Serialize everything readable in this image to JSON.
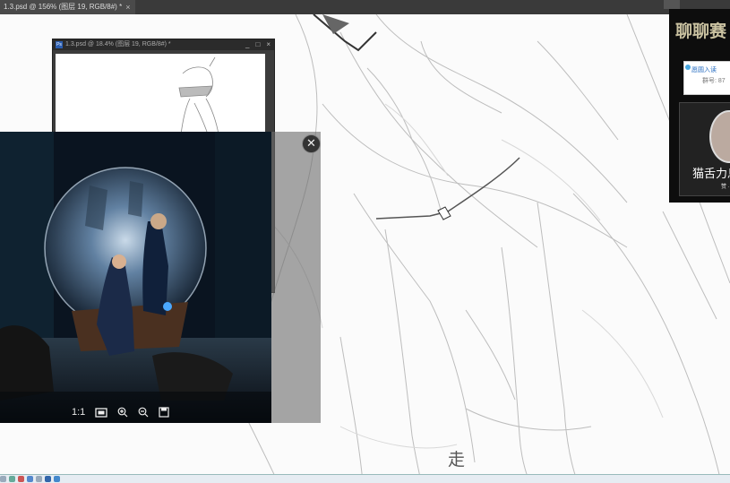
{
  "document_tab": {
    "title": "1.3.psd @ 156% (图层 19, RGB/8#) *",
    "close": "×"
  },
  "sub_window": {
    "title": "1.3.psd @ 18.4% (图层 19, RGB/8#) *",
    "ps_label": "Ps",
    "controls": {
      "minimize": "_",
      "maximize": "□",
      "close": "×"
    }
  },
  "image_viewer": {
    "close": "✕",
    "tools": {
      "actual_size": "1:1",
      "fit": "fit-screen-icon",
      "zoom_in": "zoom-in-icon",
      "zoom_out": "zoom-out-icon",
      "save": "save-icon"
    }
  },
  "chat_panel": {
    "title": "聊聊赛",
    "card_line1": "愿圆入读",
    "card_line2": "群号: 87",
    "streamer_name": "猫舌力息",
    "streamer_sub": "赞 ·"
  },
  "caption": "走",
  "colors": {
    "accent": "#2a6fc2",
    "dark_bar": "#3a3a3a",
    "viewer_bg": "#6e6e6e"
  }
}
